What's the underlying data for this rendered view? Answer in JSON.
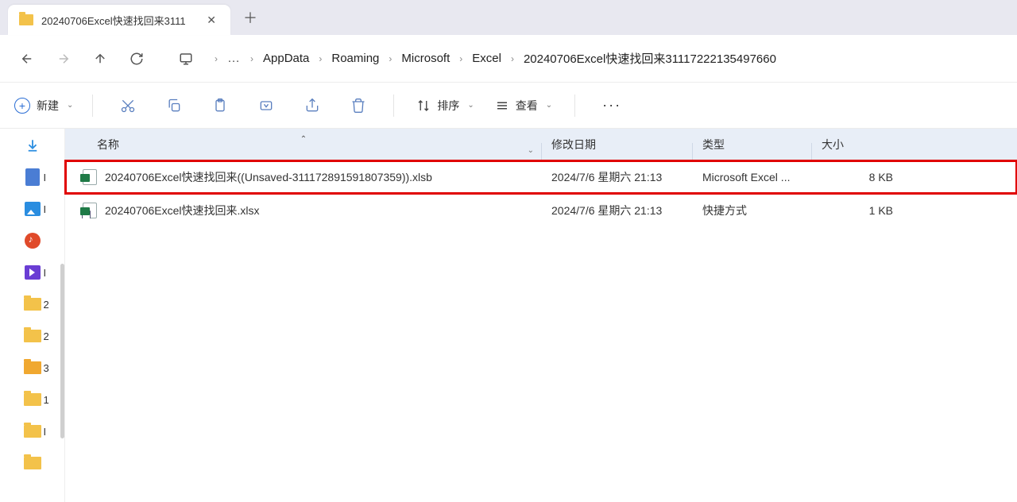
{
  "tab": {
    "title": "20240706Excel快速找回来3111"
  },
  "breadcrumb": {
    "items": [
      "AppData",
      "Roaming",
      "Microsoft",
      "Excel",
      "20240706Excel快速找回来31117222135497660"
    ]
  },
  "toolbar": {
    "new_label": "新建",
    "sort_label": "排序",
    "view_label": "查看"
  },
  "columns": {
    "name": "名称",
    "modified": "修改日期",
    "type": "类型",
    "size": "大小"
  },
  "files": [
    {
      "name": "20240706Excel快速找回来((Unsaved-311172891591807359)).xlsb",
      "modified": "2024/7/6 星期六 21:13",
      "type": "Microsoft Excel ...",
      "size": "8 KB",
      "highlighted": true,
      "shortcut": false
    },
    {
      "name": "20240706Excel快速找回来.xlsx",
      "modified": "2024/7/6 星期六 21:13",
      "type": "快捷方式",
      "size": "1 KB",
      "highlighted": false,
      "shortcut": true
    }
  ],
  "sidebar_hints": [
    "",
    "I",
    "I",
    "",
    "I",
    "2",
    "2",
    "3",
    "1",
    "I"
  ]
}
